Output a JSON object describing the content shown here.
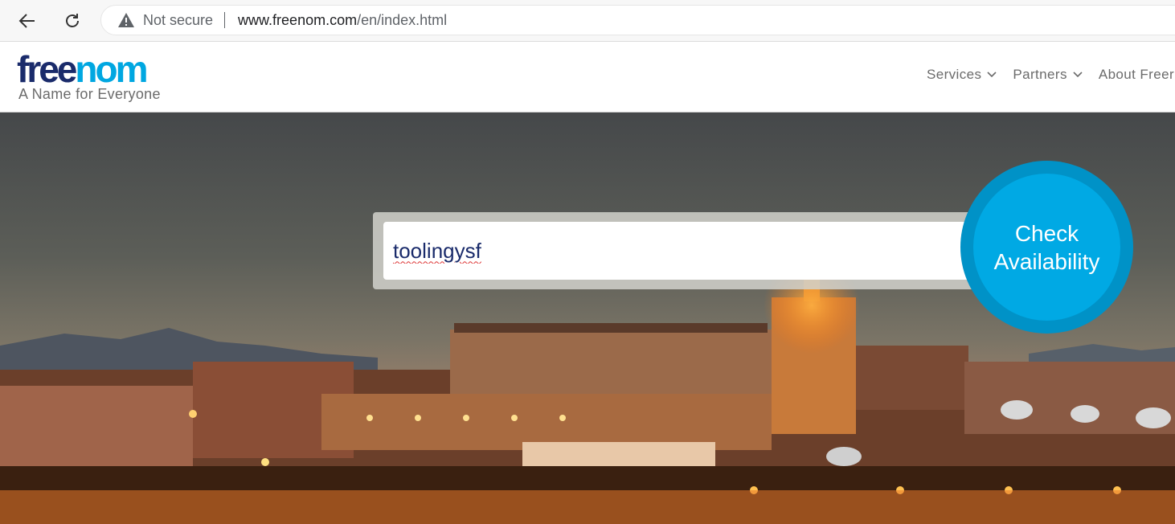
{
  "browser": {
    "not_secure": "Not secure",
    "url_host": "www.freenom.com",
    "url_path": "/en/index.html"
  },
  "header": {
    "logo_free": "free",
    "logo_nom": "nom",
    "tagline": "A Name for Everyone",
    "nav": [
      {
        "label": "Services"
      },
      {
        "label": "Partners"
      },
      {
        "label": "About Freer"
      }
    ]
  },
  "hero": {
    "search_value": "toolingysf",
    "check_line1": "Check",
    "check_line2": "Availability"
  },
  "colors": {
    "brand_dark": "#1a2b6b",
    "brand_blue": "#00a7e1",
    "button_ring": "#0092c7"
  }
}
